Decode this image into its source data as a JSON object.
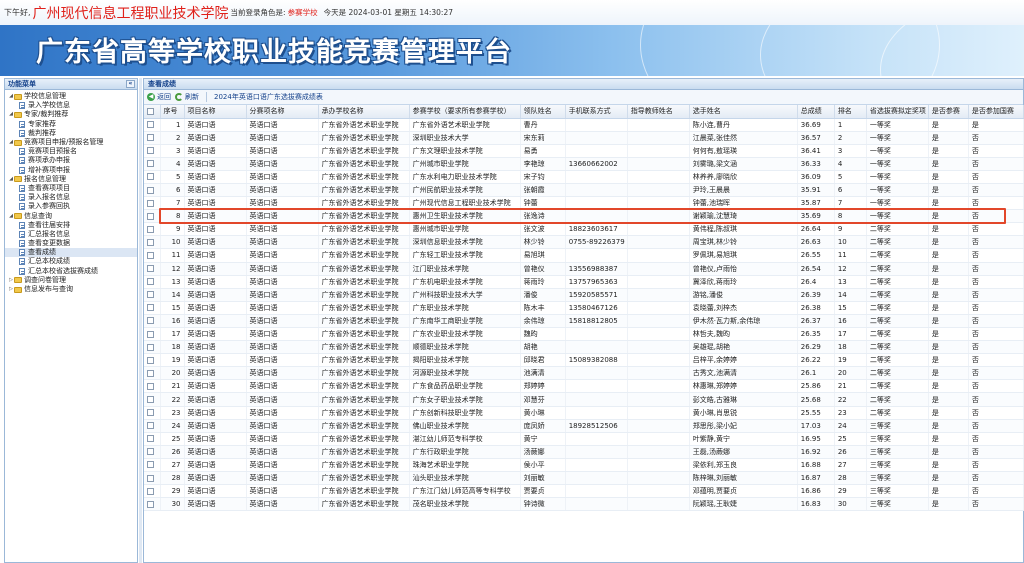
{
  "top": {
    "greeting": "下午好,",
    "school": "广州现代信息工程职业技术学院",
    "role_prefix": "当前登录角色是:",
    "role": "参赛学校",
    "date": "今天是 2024-03-01 星期五 14:30:27"
  },
  "banner": {
    "title": "广东省高等学校职业技能竞赛管理平台"
  },
  "sidebar": {
    "title": "功能菜单",
    "collapse": "«",
    "items": [
      {
        "label": "学校信息管理",
        "level": 0,
        "type": "folder",
        "toggle": "◢"
      },
      {
        "label": "录入学校信息",
        "level": 1,
        "type": "doc"
      },
      {
        "label": "专家/裁判推荐",
        "level": 0,
        "type": "folder",
        "toggle": "◢"
      },
      {
        "label": "专家推荐",
        "level": 1,
        "type": "doc"
      },
      {
        "label": "裁判推荐",
        "level": 1,
        "type": "doc"
      },
      {
        "label": "竞赛项目申报/预报名管理",
        "level": 0,
        "type": "folder",
        "toggle": "◢"
      },
      {
        "label": "竞赛项目预报名",
        "level": 1,
        "type": "doc"
      },
      {
        "label": "赛项承办申报",
        "level": 1,
        "type": "doc"
      },
      {
        "label": "增补赛项申报",
        "level": 1,
        "type": "doc"
      },
      {
        "label": "报名信息管理",
        "level": 0,
        "type": "folder",
        "toggle": "◢"
      },
      {
        "label": "查看赛项项目",
        "level": 1,
        "type": "doc"
      },
      {
        "label": "录入报名信息",
        "level": 1,
        "type": "doc"
      },
      {
        "label": "录入参赛回执",
        "level": 1,
        "type": "doc"
      },
      {
        "label": "信息查询",
        "level": 0,
        "type": "folder",
        "toggle": "◢"
      },
      {
        "label": "查看往届安排",
        "level": 1,
        "type": "doc"
      },
      {
        "label": "汇总报名信息",
        "level": 1,
        "type": "doc"
      },
      {
        "label": "查看变更数据",
        "level": 1,
        "type": "doc"
      },
      {
        "label": "查看成绩",
        "level": 1,
        "type": "doc",
        "selected": true
      },
      {
        "label": "汇总本校成绩",
        "level": 1,
        "type": "doc"
      },
      {
        "label": "汇总本校省选拔赛成绩",
        "level": 1,
        "type": "doc"
      },
      {
        "label": "调查问卷管理",
        "level": 0,
        "type": "folder",
        "toggle": "▷"
      },
      {
        "label": "信息发布与查询",
        "level": 0,
        "type": "folder",
        "toggle": "▷"
      }
    ]
  },
  "main": {
    "title": "查看成绩",
    "toolbar": {
      "back": "返回",
      "refresh": "刷新",
      "caption": "2024年英语口语广东选拔赛成绩表"
    },
    "headers": [
      "序号",
      "项目名称",
      "分赛项名称",
      "承办学校名称",
      "参赛学校（要求所有参赛学校）",
      "领队姓名",
      "手机联系方式",
      "指导教师姓名",
      "选手姓名",
      "总成绩",
      "排名",
      "省选拔赛拟定奖项",
      "是否参赛",
      "是否参加国赛"
    ],
    "rows": [
      [
        "1",
        "英语口语",
        "英语口语",
        "广东省外语艺术职业学院",
        "广东省外语艺术职业学院",
        "曹丹",
        "",
        "",
        "陈小连,曹丹",
        "36.69",
        "1",
        "一等奖",
        "是",
        "是"
      ],
      [
        "2",
        "英语口语",
        "英语口语",
        "广东省外语艺术职业学院",
        "深圳职业技术大学",
        "宋东莉",
        "",
        "",
        "江晨菜,张佳然",
        "36.57",
        "2",
        "一等奖",
        "是",
        "否"
      ],
      [
        "3",
        "英语口语",
        "英语口语",
        "广东省外语艺术职业学院",
        "广东文理职业技术学院",
        "易勇",
        "",
        "",
        "何何有,敖瑶瑛",
        "36.41",
        "3",
        "一等奖",
        "是",
        "否"
      ],
      [
        "4",
        "英语口语",
        "英语口语",
        "广东省外语艺术职业学院",
        "广州城市职业学院",
        "李艳琼",
        "13660662002",
        "",
        "刘雾璐,梁文涵",
        "36.33",
        "4",
        "一等奖",
        "是",
        "否"
      ],
      [
        "5",
        "英语口语",
        "英语口语",
        "广东省外语艺术职业学院",
        "广东水利电力职业技术学院",
        "宋子钧",
        "",
        "",
        "林养养,廖晓欣",
        "36.09",
        "5",
        "一等奖",
        "是",
        "否"
      ],
      [
        "6",
        "英语口语",
        "英语口语",
        "广东省外语艺术职业学院",
        "广州民航职业技术学院",
        "张朝霞",
        "",
        "",
        "尹玲,王晨晨",
        "35.91",
        "6",
        "一等奖",
        "是",
        "否"
      ],
      [
        "7",
        "英语口语",
        "英语口语",
        "广东省外语艺术职业学院",
        "广州现代信息工程职业技术学院",
        "钟蕾",
        "",
        "",
        "钟蕾,池瑞晖",
        "35.87",
        "7",
        "一等奖",
        "是",
        "否"
      ],
      [
        "8",
        "英语口语",
        "英语口语",
        "广东省外语艺术职业学院",
        "惠州卫生职业技术学院",
        "张逸诗",
        "",
        "",
        "谢颖瑜,沈慧琦",
        "35.69",
        "8",
        "一等奖",
        "是",
        "否"
      ],
      [
        "9",
        "英语口语",
        "英语口语",
        "广东省外语艺术职业学院",
        "惠州城市职业学院",
        "张文波",
        "18823603617",
        "",
        "黄伟程,陈叔琪",
        "26.64",
        "9",
        "二等奖",
        "是",
        "否"
      ],
      [
        "10",
        "英语口语",
        "英语口语",
        "广东省外语艺术职业学院",
        "深圳信息职业技术学院",
        "林少铃",
        "0755-89226379",
        "",
        "周宝琪,林少铃",
        "26.63",
        "10",
        "二等奖",
        "是",
        "否"
      ],
      [
        "11",
        "英语口语",
        "英语口语",
        "广东省外语艺术职业学院",
        "广东轻工职业技术学院",
        "易旭琪",
        "",
        "",
        "罗佩琪,易旭琪",
        "26.55",
        "11",
        "二等奖",
        "是",
        "否"
      ],
      [
        "12",
        "英语口语",
        "英语口语",
        "广东省外语艺术职业学院",
        "江门职业技术学院",
        "曾艳仪",
        "13556988387",
        "",
        "曾艳仪,卢雨怡",
        "26.54",
        "12",
        "二等奖",
        "是",
        "否"
      ],
      [
        "13",
        "英语口语",
        "英语口语",
        "广东省外语艺术职业学院",
        "广东机电职业技术学院",
        "蒋雨玲",
        "13757965363",
        "",
        "冀泽欣,蒋雨玲",
        "26.4",
        "13",
        "二等奖",
        "是",
        "否"
      ],
      [
        "14",
        "英语口语",
        "英语口语",
        "广东省外语艺术职业学院",
        "广州科技职业技术大学",
        "潘俊",
        "15920585571",
        "",
        "游铭,潘俊",
        "26.39",
        "14",
        "二等奖",
        "是",
        "否"
      ],
      [
        "15",
        "英语口语",
        "英语口语",
        "广东省外语艺术职业学院",
        "广东职业技术学院",
        "陈木丰",
        "13580467126",
        "",
        "袁晓蕾,刘梓杰",
        "26.38",
        "15",
        "二等奖",
        "是",
        "否"
      ],
      [
        "16",
        "英语口语",
        "英语口语",
        "广东省外语艺术职业学院",
        "广东南华工商职业学院",
        "余伟琼",
        "15818812805",
        "",
        "伊木然·瓦力斯,余伟琼",
        "26.37",
        "16",
        "二等奖",
        "是",
        "否"
      ],
      [
        "17",
        "英语口语",
        "英语口语",
        "广东省外语艺术职业学院",
        "广东农业职业技术学院",
        "魏昀",
        "",
        "",
        "林哲夫,魏昀",
        "26.35",
        "17",
        "二等奖",
        "是",
        "否"
      ],
      [
        "18",
        "英语口语",
        "英语口语",
        "广东省外语艺术职业学院",
        "顺德职业技术学院",
        "胡艳",
        "",
        "",
        "吴雄琨,胡艳",
        "26.29",
        "18",
        "二等奖",
        "是",
        "否"
      ],
      [
        "19",
        "英语口语",
        "英语口语",
        "广东省外语艺术职业学院",
        "揭阳职业技术学院",
        "邱晓君",
        "15089382088",
        "",
        "吕梓平,余婷婷",
        "26.22",
        "19",
        "二等奖",
        "是",
        "否"
      ],
      [
        "20",
        "英语口语",
        "英语口语",
        "广东省外语艺术职业学院",
        "河源职业技术学院",
        "池满清",
        "",
        "",
        "古秀文,池满清",
        "26.1",
        "20",
        "二等奖",
        "是",
        "否"
      ],
      [
        "21",
        "英语口语",
        "英语口语",
        "广东省外语艺术职业学院",
        "广东食品药品职业学院",
        "郑婷婷",
        "",
        "",
        "林惠琳,郑婷婷",
        "25.86",
        "21",
        "二等奖",
        "是",
        "否"
      ],
      [
        "22",
        "英语口语",
        "英语口语",
        "广东省外语艺术职业学院",
        "广东女子职业技术学院",
        "邓慧芬",
        "",
        "",
        "彭文皓,古雅琳",
        "25.68",
        "22",
        "二等奖",
        "是",
        "否"
      ],
      [
        "23",
        "英语口语",
        "英语口语",
        "广东省外语艺术职业学院",
        "广东创新科技职业学院",
        "黄小琳",
        "",
        "",
        "黄小琳,肖思锐",
        "25.55",
        "23",
        "二等奖",
        "是",
        "否"
      ],
      [
        "24",
        "英语口语",
        "英语口语",
        "广东省外语艺术职业学院",
        "佛山职业技术学院",
        "庞凤娇",
        "18928512506",
        "",
        "郑思彤,梁小妃",
        "17.03",
        "24",
        "三等奖",
        "是",
        "否"
      ],
      [
        "25",
        "英语口语",
        "英语口语",
        "广东省外语艺术职业学院",
        "湛江幼儿师范专科学校",
        "黄宁",
        "",
        "",
        "叶紫静,黄宁",
        "16.95",
        "25",
        "三等奖",
        "是",
        "否"
      ],
      [
        "26",
        "英语口语",
        "英语口语",
        "广东省外语艺术职业学院",
        "广东行政职业学院",
        "汤蕨娜",
        "",
        "",
        "王磊,汤蕨娜",
        "16.92",
        "26",
        "三等奖",
        "是",
        "否"
      ],
      [
        "27",
        "英语口语",
        "英语口语",
        "广东省外语艺术职业学院",
        "珠海艺术职业学院",
        "侯小平",
        "",
        "",
        "梁依利,郑玉良",
        "16.88",
        "27",
        "三等奖",
        "是",
        "否"
      ],
      [
        "28",
        "英语口语",
        "英语口语",
        "广东省外语艺术职业学院",
        "汕头职业技术学院",
        "刘丽敏",
        "",
        "",
        "陈梓琳,刘丽敏",
        "16.87",
        "28",
        "三等奖",
        "是",
        "否"
      ],
      [
        "29",
        "英语口语",
        "英语口语",
        "广东省外语艺术职业学院",
        "广东江门幼儿师范高等专科学校",
        "贾要贞",
        "",
        "",
        "邓蕴明,贾要贞",
        "16.86",
        "29",
        "三等奖",
        "是",
        "否"
      ],
      [
        "30",
        "英语口语",
        "英语口语",
        "广东省外语艺术职业学院",
        "茂名职业技术学院",
        "钟诗微",
        "",
        "",
        "阮颖瑶,王耿婕",
        "16.83",
        "30",
        "三等奖",
        "是",
        "否"
      ]
    ]
  }
}
